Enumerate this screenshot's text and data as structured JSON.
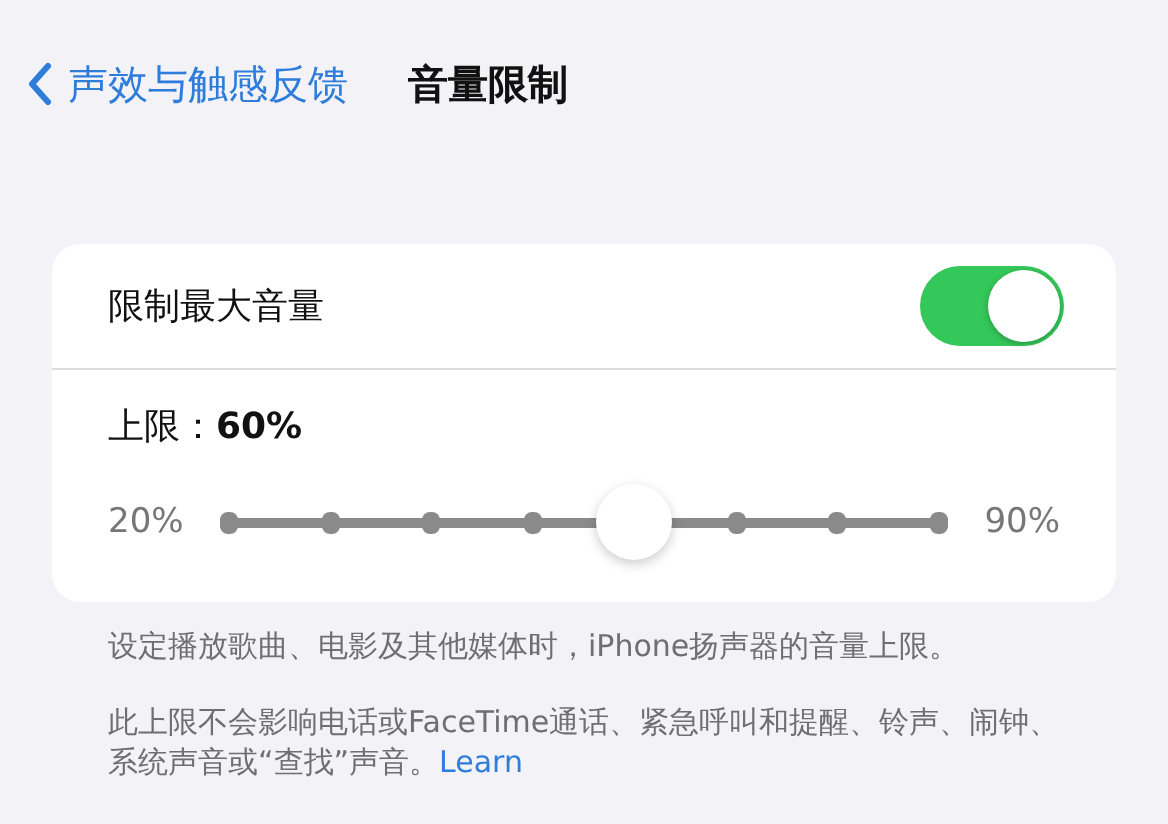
{
  "nav": {
    "back_label": "声效与触感反馈",
    "title": "音量限制"
  },
  "limit_toggle": {
    "label": "限制最大音量",
    "on": true
  },
  "slider": {
    "caption": "上限：",
    "value": "60%",
    "min_label": "20%",
    "max_label": "90%",
    "level": 0.571
  },
  "footer": {
    "note": "设定播放歌曲、电影及其他媒体时，iPhone扬声器的音量上限。",
    "detail": "此上限不会影响电话或FaceTime通话、紧急呼叫和提醒、铃声、闹钟、系统声音或“查找”声音。",
    "link": "Learn"
  }
}
